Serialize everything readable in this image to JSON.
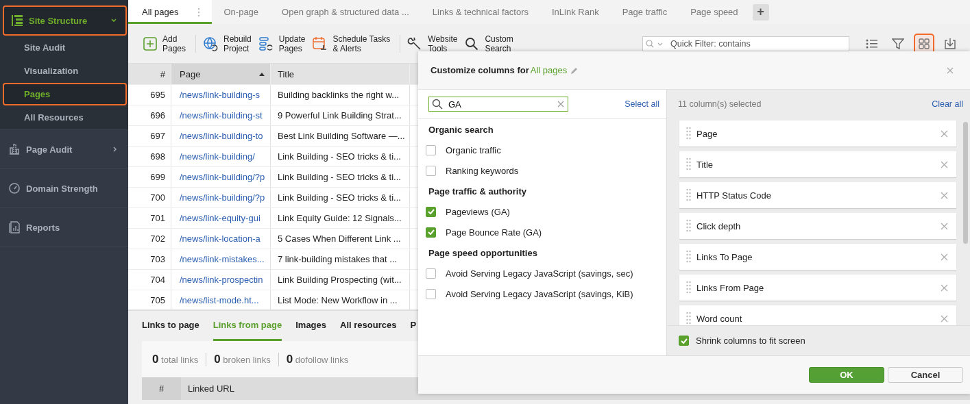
{
  "sidebar": {
    "items": [
      {
        "label": "Site Structure",
        "kind": "group",
        "expanded": true,
        "highlighted": true,
        "children": [
          {
            "label": "Site Audit",
            "selected": false,
            "highlighted": false
          },
          {
            "label": "Visualization",
            "selected": false,
            "highlighted": false
          },
          {
            "label": "Pages",
            "selected": true,
            "highlighted": true
          },
          {
            "label": "All Resources",
            "selected": false,
            "highlighted": false
          }
        ]
      },
      {
        "label": "Page Audit",
        "kind": "group",
        "expanded": false,
        "highlighted": false
      },
      {
        "label": "Domain Strength",
        "kind": "link",
        "highlighted": false
      },
      {
        "label": "Reports",
        "kind": "link",
        "highlighted": false
      }
    ]
  },
  "tabs": [
    {
      "label": "All pages",
      "selected": true
    },
    {
      "label": "On-page",
      "selected": false
    },
    {
      "label": "Open graph & structured data ...",
      "selected": false
    },
    {
      "label": "Links & technical factors",
      "selected": false
    },
    {
      "label": "InLink Rank",
      "selected": false
    },
    {
      "label": "Page traffic",
      "selected": false
    },
    {
      "label": "Page speed",
      "selected": false
    }
  ],
  "add_tab_button": "+",
  "toolbar": {
    "buttons": [
      {
        "lines": [
          "Add",
          "Pages"
        ]
      },
      {
        "lines": [
          "Rebuild",
          "Project"
        ]
      },
      {
        "lines": [
          "Update",
          "Pages"
        ]
      },
      {
        "lines": [
          "Schedule Tasks",
          "& Alerts"
        ]
      },
      {
        "lines": [
          "Website",
          "Tools"
        ]
      },
      {
        "lines": [
          "Custom",
          "Search"
        ]
      }
    ],
    "quick_filter": {
      "placeholder": "Quick Filter: contains"
    },
    "view_buttons": [
      {
        "highlighted": false
      },
      {
        "highlighted": false
      },
      {
        "highlighted": true
      },
      {
        "highlighted": false
      }
    ]
  },
  "table": {
    "columns": [
      {
        "label": "#",
        "sorted": false
      },
      {
        "label": "Page",
        "sorted": true
      },
      {
        "label": "Title",
        "sorted": false
      }
    ],
    "rows": [
      {
        "number": "695",
        "page": "/news/link-building-s",
        "title": "Building backlinks the right w..."
      },
      {
        "number": "696",
        "page": "/news/link-building-st",
        "title": "9 Powerful Link Building Strat..."
      },
      {
        "number": "697",
        "page": "/news/link-building-to",
        "title": "Best Link Building Software —..."
      },
      {
        "number": "698",
        "page": "/news/link-building/",
        "title": "Link Building - SEO tricks & ti..."
      },
      {
        "number": "699",
        "page": "/news/link-building/?p",
        "title": "Link Building - SEO tricks & ti..."
      },
      {
        "number": "700",
        "page": "/news/link-building/?p",
        "title": "Link Building - SEO tricks & ti..."
      },
      {
        "number": "701",
        "page": "/news/link-equity-gui",
        "title": "Link Equity Guide: 12 Signals..."
      },
      {
        "number": "702",
        "page": "/news/link-location-a",
        "title": "5 Cases When Different Link ..."
      },
      {
        "number": "703",
        "page": "/news/link-mistakes...",
        "title": "7 link-building mistakes that ..."
      },
      {
        "number": "704",
        "page": "/news/link-prospectin",
        "title": "Link Building Prospecting (wit..."
      },
      {
        "number": "705",
        "page": "/news/list-mode.ht...",
        "title": "List Mode: New Workflow in ..."
      }
    ]
  },
  "details": {
    "tabs": [
      {
        "label": "Links to page",
        "selected": false
      },
      {
        "label": "Links from page",
        "selected": true
      },
      {
        "label": "Images",
        "selected": false
      },
      {
        "label": "All resources",
        "selected": false
      },
      {
        "label": "P",
        "selected": false
      }
    ],
    "stats": [
      "**0** total links",
      "**0** broken links",
      "**0** dofollow links"
    ],
    "columns": [
      "#",
      "Linked URL"
    ]
  },
  "dialog": {
    "title": "Customize columns for",
    "view_name": "All pages",
    "search": {
      "value": "GA"
    },
    "select_all": "Select all",
    "groups": [
      {
        "title": "Organic search",
        "items": [
          {
            "label": "Organic traffic",
            "checked": false
          },
          {
            "label": "Ranking keywords",
            "checked": false
          }
        ]
      },
      {
        "title": "Page traffic & authority",
        "items": [
          {
            "label": "Pageviews (GA)",
            "checked": true
          },
          {
            "label": "Page Bounce Rate (GA)",
            "checked": true
          }
        ]
      },
      {
        "title": "Page speed opportunities",
        "items": [
          {
            "label": "Avoid Serving Legacy JavaScript (savings, sec)",
            "checked": false
          },
          {
            "label": "Avoid Serving Legacy JavaScript (savings, KiB)",
            "checked": false
          }
        ]
      }
    ],
    "selected_count": "11 column(s) selected",
    "clear_all": "Clear all",
    "selected_columns": [
      "Page",
      "Title",
      "HTTP Status Code",
      "Click depth",
      "Links To Page",
      "Links From Page",
      "Word count"
    ],
    "shrink": {
      "label": "Shrink columns to fit screen",
      "checked": true
    },
    "ok": "OK",
    "cancel": "Cancel"
  }
}
